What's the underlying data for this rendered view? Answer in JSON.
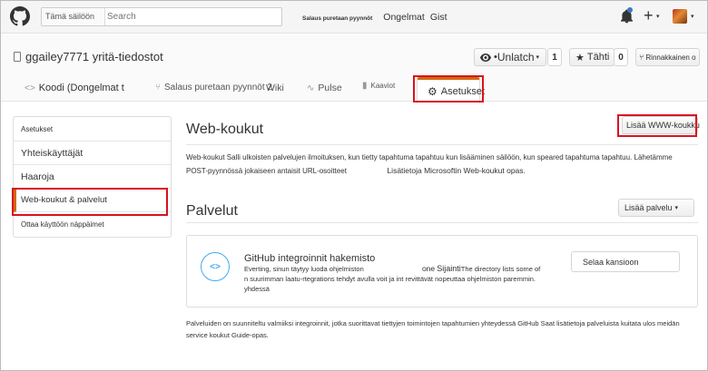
{
  "header": {
    "search_scope": "Tämä säilöön",
    "search_placeholder": "Search",
    "link_small": "Salaus puretaan pyynnöt",
    "link_issues": "Ongelmat",
    "link_gist": "Gist",
    "plus": "+",
    "caret": "▾"
  },
  "repo": {
    "title": "ggailey7771 yritä-tiedostot",
    "unwatch_label": "Unlatch",
    "unwatch_prefix": "• ",
    "unwatch_count": "1",
    "star_label": "Tähti",
    "star_count": "0",
    "fork_label": "Rinnakkainen o"
  },
  "tabs": [
    {
      "label": "Koodi (Dongelmat t"
    },
    {
      "label": "Salaus puretaan pyynnöt 2",
      "extra": "Wiki"
    },
    {
      "label": "Pulse"
    },
    {
      "label": "Kaaviot"
    },
    {
      "label": "Asetukset"
    }
  ],
  "sidebar": {
    "heading": "Asetukset",
    "items": [
      {
        "label": "Yhteiskäyttäjät"
      },
      {
        "label": "Haaroja"
      },
      {
        "label": "Web-koukut & palvelut"
      },
      {
        "label": "Ottaa käyttöön näppäimet"
      }
    ]
  },
  "webhooks": {
    "title": "Web-koukut",
    "add_button": "Lisää WWW-koukku",
    "description": "Web-koukut Salli ulkoisten palvelujen ilmoituksen, kun tietty tapahtuma tapahtuu kun lisääminen säilöön, kun speared tapahtuma tapahtuu. Lähetämme POST-pyynnössä jokaiseen antaisit URL-osoitteet",
    "guide_link": "Lisätietoja Microsoftin Web-koukut opas."
  },
  "services": {
    "title": "Palvelut",
    "add_button": "Lisää palvelu",
    "card": {
      "title": "GitHub integroinnit hakemisto",
      "desc_line1": "Everting, sinun täytyy luoda ohjelmiston",
      "inline_one": "one",
      "inline_location": "Sijainti",
      "inline_rest": "The directory lists some of",
      "desc_line2": "n suurimman laatu-rtegrations tehdyt avulla voit ja int revittävät nopeuttaa ohjelmiston paremmin.",
      "desc_line3": "yhdessä",
      "browse_button": "Selaa kansioon"
    },
    "footer": "Palveluiden on suunniteltu valmiiksi integroinnit, jotka suorittavat tiettyjen toimintojen tapahtumien yhteydessä GitHub Saat lisätietoja palveluista kuitata ulos meidän service koukut Guide-opas."
  },
  "colors": {
    "accent_tab": "#d26911",
    "highlight": "#d9131e",
    "integration_blue": "#41aaf0"
  }
}
